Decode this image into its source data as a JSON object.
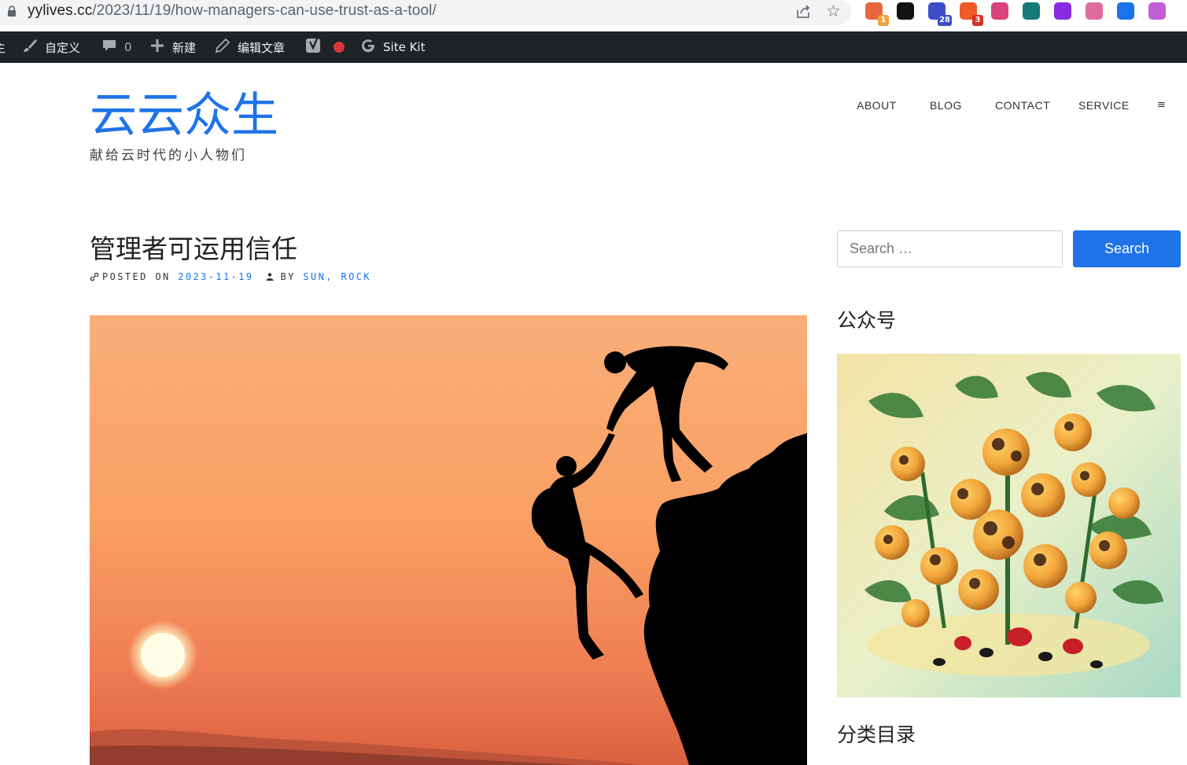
{
  "browser": {
    "url_host": "yylives.cc",
    "url_path": "/2023/11/19/how-managers-can-use-trust-as-a-tool/",
    "extensions": [
      {
        "name": "extension-1-icon",
        "color": "#e8663d",
        "badge": "1",
        "badge_color": "#e8a33d"
      },
      {
        "name": "notion-icon",
        "color": "#111111",
        "badge": ""
      },
      {
        "name": "graduation-cap-icon",
        "color": "#3b4ec8",
        "badge": "28",
        "badge_color": "#3b4ec8"
      },
      {
        "name": "extension-3-icon",
        "color": "#f05a2a",
        "badge": "3",
        "badge_color": "#d93025"
      },
      {
        "name": "translate-icon",
        "color": "#d9447a",
        "badge": ""
      },
      {
        "name": "grid-icon",
        "color": "#177a7a",
        "badge": ""
      },
      {
        "name": "letter-r-icon",
        "color": "#8a2be2",
        "badge": ""
      },
      {
        "name": "crown-icon",
        "color": "#e06c9f",
        "badge": ""
      },
      {
        "name": "paragraph-icon",
        "color": "#1a73e8",
        "badge": ""
      },
      {
        "name": "openai-icon",
        "color": "#c25fd6",
        "badge": ""
      }
    ]
  },
  "adminbar": {
    "edge_label": "主",
    "customize_label": "自定义",
    "comments_count": "0",
    "new_label": "新建",
    "edit_label": "编辑文章",
    "sitekit_label": "Site Kit"
  },
  "site": {
    "title": "云云众生",
    "description": "献给云时代的小人物们"
  },
  "nav": {
    "items": [
      "ABOUT",
      "BLOG",
      "CONTACT",
      "SERVICE"
    ],
    "more": "≡"
  },
  "post": {
    "title": "管理者可运用信任",
    "posted_on_label": "POSTED ON",
    "date": "2023-11-19",
    "by_label": "BY",
    "author": "SUN, ROCK"
  },
  "sidebar": {
    "search_placeholder": "Search …",
    "search_button": "Search",
    "widget1_title": "公众号",
    "widget2_title": "分类目录"
  }
}
